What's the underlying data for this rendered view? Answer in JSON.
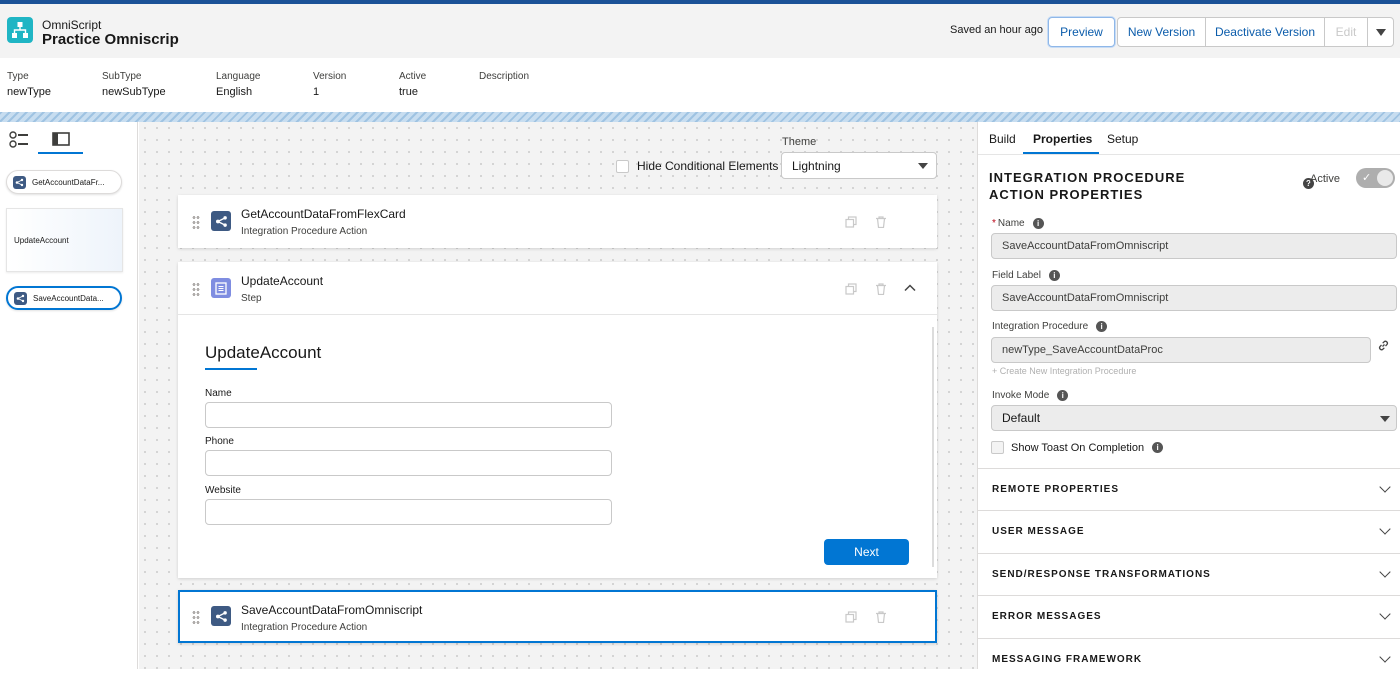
{
  "header": {
    "app_name": "OmniScript",
    "title": "Practice Omniscrip",
    "saved_status": "Saved an hour ago",
    "buttons": {
      "preview": "Preview",
      "new_version": "New Version",
      "deactivate_version": "Deactivate Version",
      "edit": "Edit"
    }
  },
  "meta": [
    {
      "label": "Type",
      "value": "newType"
    },
    {
      "label": "SubType",
      "value": "newSubType"
    },
    {
      "label": "Language",
      "value": "English"
    },
    {
      "label": "Version",
      "value": "1"
    },
    {
      "label": "Active",
      "value": "true"
    },
    {
      "label": "Description",
      "value": ""
    }
  ],
  "left_panel": {
    "items": [
      {
        "label": "GetAccountDataFr..."
      },
      {
        "label": "UpdateAccount"
      },
      {
        "label": "SaveAccountData..."
      }
    ]
  },
  "canvas": {
    "theme_label": "Theme",
    "theme_value": "Lightning",
    "hide_conditional_label": "Hide Conditional Elements",
    "elements": [
      {
        "title": "GetAccountDataFromFlexCard",
        "subtitle": "Integration Procedure Action"
      },
      {
        "title": "UpdateAccount",
        "subtitle": "Step"
      },
      {
        "title": "SaveAccountDataFromOmniscript",
        "subtitle": "Integration Procedure Action"
      }
    ],
    "step": {
      "heading": "UpdateAccount",
      "fields": [
        {
          "label": "Name",
          "value": ""
        },
        {
          "label": "Phone",
          "value": ""
        },
        {
          "label": "Website",
          "value": ""
        }
      ],
      "next_label": "Next"
    }
  },
  "right_panel": {
    "tabs": [
      "Build",
      "Properties",
      "Setup"
    ],
    "active_tab": "Properties",
    "heading_line1": "INTEGRATION PROCEDURE",
    "heading_line2": "ACTION PROPERTIES",
    "active_label": "Active",
    "active_value": true,
    "name_label": "Name",
    "name_value": "SaveAccountDataFromOmniscript",
    "field_label_label": "Field Label",
    "field_label_value": "SaveAccountDataFromOmniscript",
    "ip_label": "Integration Procedure",
    "ip_value": "newType_SaveAccountDataProc",
    "create_ip_link": "+ Create New Integration Procedure",
    "invoke_mode_label": "Invoke Mode",
    "invoke_mode_value": "Default",
    "show_toast_label": "Show Toast On Completion",
    "sections": [
      "REMOTE PROPERTIES",
      "USER MESSAGE",
      "SEND/RESPONSE TRANSFORMATIONS",
      "ERROR MESSAGES",
      "MESSAGING FRAMEWORK"
    ]
  },
  "colors": {
    "brand_blue": "#0176d3",
    "app_icon": "#1fb5c4",
    "ip_icon": "#3e5a83",
    "step_icon": "#7f8de1"
  }
}
